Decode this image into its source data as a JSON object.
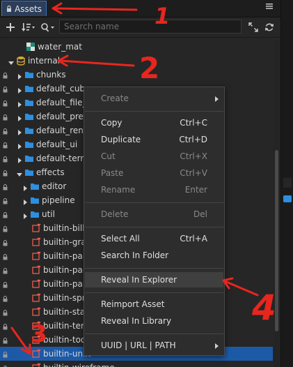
{
  "panel": {
    "tab_label": "Assets",
    "menu_icon": "hamburger-icon",
    "search_placeholder": "Search name"
  },
  "tree": [
    {
      "label": "water_mat",
      "type": "material",
      "depth": 1,
      "expanded": null,
      "locked": false
    },
    {
      "label": "internal",
      "type": "database",
      "depth": 0,
      "expanded": true,
      "locked": false
    },
    {
      "label": "chunks",
      "type": "folder",
      "depth": 1,
      "expanded": false,
      "locked": true
    },
    {
      "label": "default_cube",
      "type": "folder",
      "depth": 1,
      "expanded": false,
      "locked": true
    },
    {
      "label": "default_file_c",
      "type": "folder",
      "depth": 1,
      "expanded": false,
      "locked": true
    },
    {
      "label": "default_prefa",
      "type": "folder",
      "depth": 1,
      "expanded": false,
      "locked": true
    },
    {
      "label": "default_rende",
      "type": "folder",
      "depth": 1,
      "expanded": false,
      "locked": true
    },
    {
      "label": "default_ui",
      "type": "folder",
      "depth": 1,
      "expanded": false,
      "locked": true
    },
    {
      "label": "default-terrai",
      "type": "folder",
      "depth": 1,
      "expanded": false,
      "locked": true
    },
    {
      "label": "effects",
      "type": "folder",
      "depth": 1,
      "expanded": true,
      "locked": true
    },
    {
      "label": "editor",
      "type": "folder",
      "depth": 2,
      "expanded": false,
      "locked": true
    },
    {
      "label": "pipeline",
      "type": "folder",
      "depth": 2,
      "expanded": false,
      "locked": true
    },
    {
      "label": "util",
      "type": "folder",
      "depth": 2,
      "expanded": false,
      "locked": true
    },
    {
      "label": "builtin-billb",
      "type": "effect",
      "depth": 2,
      "expanded": null,
      "locked": true
    },
    {
      "label": "builtin-grap",
      "type": "effect",
      "depth": 2,
      "expanded": null,
      "locked": true
    },
    {
      "label": "builtin-parti",
      "type": "effect",
      "depth": 2,
      "expanded": null,
      "locked": true
    },
    {
      "label": "builtin-parti",
      "type": "effect",
      "depth": 2,
      "expanded": null,
      "locked": true
    },
    {
      "label": "builtin-parti",
      "type": "effect",
      "depth": 2,
      "expanded": null,
      "locked": true
    },
    {
      "label": "builtin-sprit",
      "type": "effect",
      "depth": 2,
      "expanded": null,
      "locked": true
    },
    {
      "label": "builtin-stanc",
      "type": "effect",
      "depth": 2,
      "expanded": null,
      "locked": true
    },
    {
      "label": "builtin-terra",
      "type": "effect",
      "depth": 2,
      "expanded": null,
      "locked": true
    },
    {
      "label": "builtin-toon",
      "type": "effect",
      "depth": 2,
      "expanded": null,
      "locked": true
    },
    {
      "label": "builtin-unlit",
      "type": "effect",
      "depth": 2,
      "expanded": null,
      "locked": true,
      "selected": true
    },
    {
      "label": "builtin-wireframe",
      "type": "effect",
      "depth": 2,
      "expanded": null,
      "locked": true
    }
  ],
  "context_menu": {
    "items": [
      {
        "label": "Create",
        "shortcut": "",
        "submenu": true,
        "disabled": true
      },
      {
        "sep": true
      },
      {
        "label": "Copy",
        "shortcut": "Ctrl+C"
      },
      {
        "label": "Duplicate",
        "shortcut": "Ctrl+D"
      },
      {
        "label": "Cut",
        "shortcut": "Ctrl+X",
        "disabled": true
      },
      {
        "label": "Paste",
        "shortcut": "Ctrl+V",
        "disabled": true
      },
      {
        "label": "Rename",
        "shortcut": "Enter",
        "disabled": true
      },
      {
        "sep": true
      },
      {
        "label": "Delete",
        "shortcut": "Del",
        "disabled": true
      },
      {
        "sep": true
      },
      {
        "label": "Select All",
        "shortcut": "Ctrl+A"
      },
      {
        "label": "Search In Folder",
        "shortcut": ""
      },
      {
        "sep": true
      },
      {
        "label": "Reveal In Explorer",
        "shortcut": "",
        "highlighted": true
      },
      {
        "sep": true
      },
      {
        "label": "Reimport Asset",
        "shortcut": ""
      },
      {
        "label": "Reveal In Library",
        "shortcut": ""
      },
      {
        "sep": true
      },
      {
        "label": "UUID | URL | PATH",
        "shortcut": "",
        "submenu": true
      }
    ]
  },
  "annotations": {
    "color": "#e8261e",
    "numbers": [
      "1",
      "2",
      "3",
      "4"
    ]
  },
  "colors": {
    "accent": "#3c75c8",
    "selected_row": "#1c5aa8",
    "folder": "#2d8fe0",
    "effect": "#f05a4a",
    "database": "#d4a93a"
  }
}
